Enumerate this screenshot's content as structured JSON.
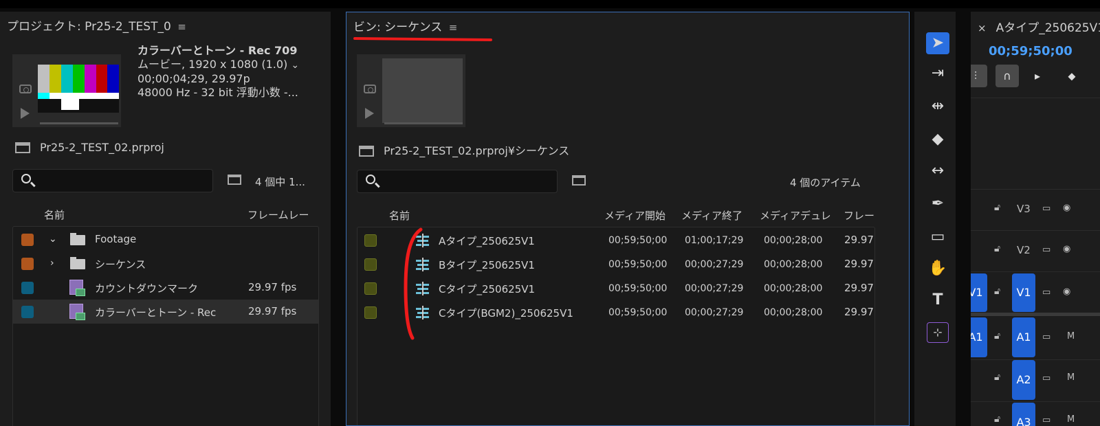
{
  "project_panel": {
    "title": "プロジェクト: Pr25-2_TEST_0",
    "menu_icon": "≡",
    "preview": {
      "clip_name": "カラーバーとトーン - Rec 709",
      "info_line1": "ムービー, 1920 x 1080 (1.0)",
      "info_line2": "00;00;04;29, 29.97p",
      "info_line3": "48000 Hz - 32 bit 浮動小数 -..."
    },
    "path": "Pr25-2_TEST_02.prproj",
    "search_value": "",
    "item_count": "4 個中 1...",
    "columns": {
      "name": "名前",
      "frame_rate": "フレームレー"
    },
    "items": [
      {
        "label": "Footage",
        "type": "folder",
        "expanded": true,
        "fps": "",
        "color": "#b0561d"
      },
      {
        "label": "シーケンス",
        "type": "folder",
        "expanded": false,
        "fps": "",
        "color": "#b0561d"
      },
      {
        "label": "カウントダウンマーク",
        "type": "clip",
        "fps": "29.97 fps",
        "color": "#0d5f80"
      },
      {
        "label": "カラーバーとトーン - Rec",
        "type": "clip",
        "fps": "29.97 fps",
        "color": "#0d5f80"
      }
    ]
  },
  "bin_panel": {
    "title": "ビン: シーケンス",
    "menu_icon": "≡",
    "path": "Pr25-2_TEST_02.prproj¥シーケンス",
    "search_value": "",
    "item_count": "4 個のアイテム",
    "columns": {
      "name": "名前",
      "media_start": "メディア開始",
      "media_end": "メディア終了",
      "media_duration": "メディアデュレ",
      "frame": "フレー"
    },
    "items": [
      {
        "label": "Aタイプ_250625V1",
        "start": "00;59;50;00",
        "end": "01;00;17;29",
        "duration": "00;00;28;00",
        "fps": "29.97",
        "color": "#4a5015"
      },
      {
        "label": "Bタイプ_250625V1",
        "start": "00;59;50;00",
        "end": "00;00;27;29",
        "duration": "00;00;28;00",
        "fps": "29.97",
        "color": "#4a5015"
      },
      {
        "label": "Cタイプ_250625V1",
        "start": "00;59;50;00",
        "end": "00;00;27;29",
        "duration": "00;00;28;00",
        "fps": "29.97",
        "color": "#4a5015"
      },
      {
        "label": "Cタイプ(BGM2)_250625V1",
        "start": "00;59;50;00",
        "end": "00;00;27;29",
        "duration": "00;00;28;00",
        "fps": "29.97",
        "color": "#4a5015"
      }
    ]
  },
  "tools": [
    "selection-tool",
    "track-select-tool",
    "ripple-edit-tool",
    "razor-tool",
    "slip-tool",
    "pen-tool",
    "rectangle-tool",
    "hand-tool",
    "type-tool",
    "generative-extend-tool"
  ],
  "timeline": {
    "close": "×",
    "title": "Aタイプ_250625V1",
    "timecode": "00;59;50;00",
    "tracks": [
      {
        "src": "",
        "name": "V3"
      },
      {
        "src": "",
        "name": "V2"
      },
      {
        "src": "V1",
        "name": "V1"
      },
      {
        "src": "A1",
        "name": "A1",
        "flag": "M"
      },
      {
        "src": "",
        "name": "A2",
        "flag": "M"
      },
      {
        "src": "",
        "name": "A3",
        "flag": "M"
      }
    ]
  },
  "colors": {
    "accent": "#2a6fe0",
    "annotation": "#ee1b1b",
    "timecode": "#4aa0ff"
  }
}
